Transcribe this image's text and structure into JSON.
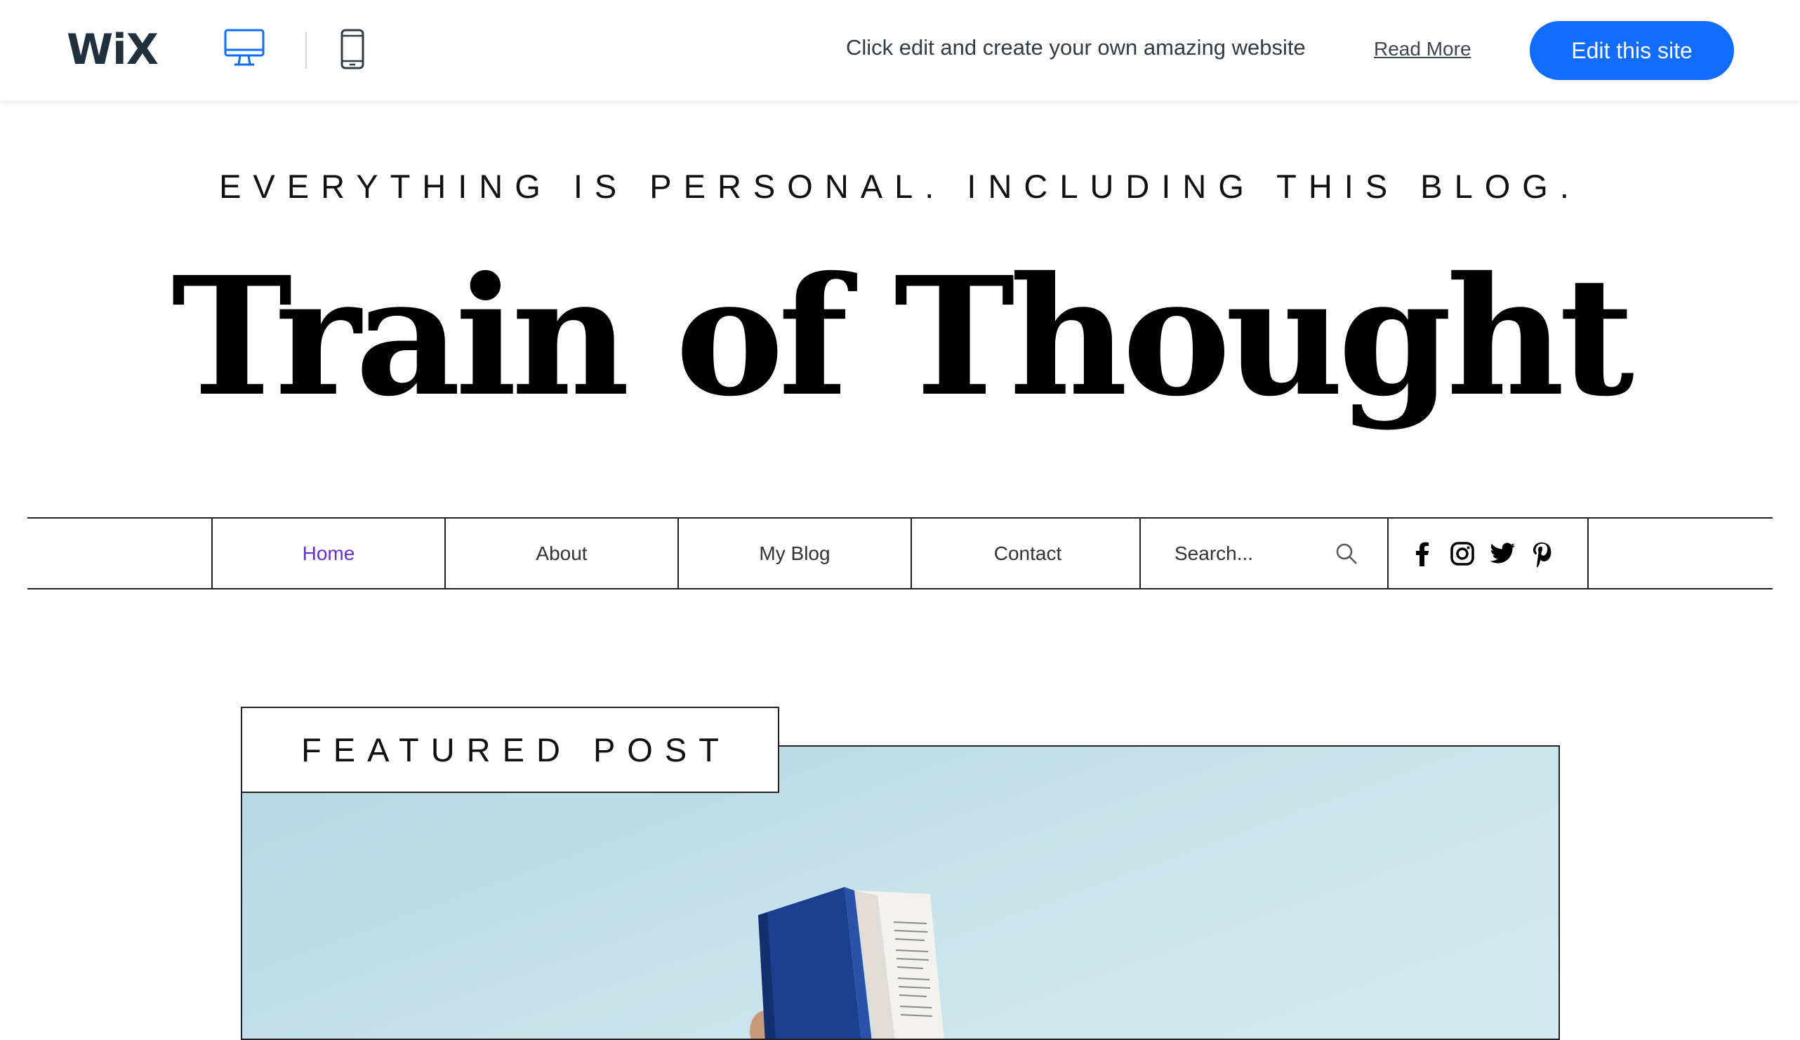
{
  "wix_bar": {
    "logo": "WiX",
    "promo_text": "Click edit and create your own amazing website",
    "read_more": "Read More",
    "edit_button": "Edit this site",
    "accent_color": "#116dff"
  },
  "header": {
    "tagline": "EVERYTHING IS PERSONAL. INCLUDING THIS BLOG.",
    "title": "Train of Thought"
  },
  "nav": {
    "items": [
      {
        "label": "Home",
        "active": true
      },
      {
        "label": "About"
      },
      {
        "label": "My Blog"
      },
      {
        "label": "Contact"
      }
    ],
    "active_color": "#6b2fd0",
    "search_placeholder": "Search...",
    "social": [
      "facebook-icon",
      "instagram-icon",
      "twitter-icon",
      "pinterest-icon"
    ]
  },
  "featured": {
    "label": "FEATURED POST"
  }
}
